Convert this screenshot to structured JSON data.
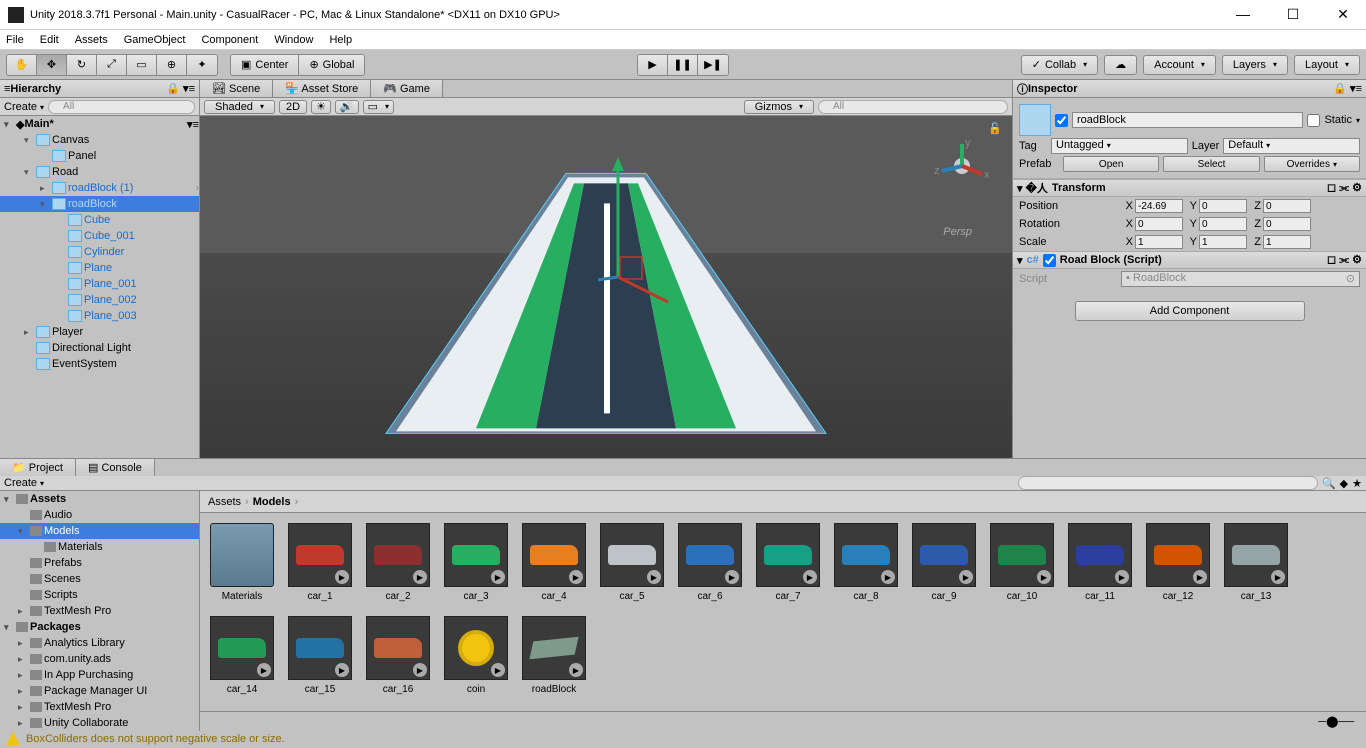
{
  "window": {
    "title": "Unity 2018.3.7f1 Personal - Main.unity - CasualRacer - PC, Mac & Linux Standalone* <DX11 on DX10 GPU>"
  },
  "menubar": [
    "File",
    "Edit",
    "Assets",
    "GameObject",
    "Component",
    "Window",
    "Help"
  ],
  "toolbar": {
    "center": "Center",
    "global": "Global",
    "collab": "Collab",
    "account": "Account",
    "layers": "Layers",
    "layout": "Layout"
  },
  "hierarchy": {
    "tab": "Hierarchy",
    "create": "Create",
    "search_placeholder": "All",
    "scene": "Main*",
    "items": [
      {
        "name": "Canvas",
        "depth": 1,
        "arrow": "▾"
      },
      {
        "name": "Panel",
        "depth": 2,
        "arrow": ""
      },
      {
        "name": "Road",
        "depth": 1,
        "arrow": "▾"
      },
      {
        "name": "roadBlock (1)",
        "depth": 2,
        "arrow": "▸",
        "blue": true
      },
      {
        "name": "roadBlock",
        "depth": 2,
        "arrow": "▾",
        "blue": true,
        "selected": true
      },
      {
        "name": "Cube",
        "depth": 3,
        "blue": true
      },
      {
        "name": "Cube_001",
        "depth": 3,
        "blue": true
      },
      {
        "name": "Cylinder",
        "depth": 3,
        "blue": true
      },
      {
        "name": "Plane",
        "depth": 3,
        "blue": true
      },
      {
        "name": "Plane_001",
        "depth": 3,
        "blue": true
      },
      {
        "name": "Plane_002",
        "depth": 3,
        "blue": true
      },
      {
        "name": "Plane_003",
        "depth": 3,
        "blue": true
      },
      {
        "name": "Player",
        "depth": 1,
        "arrow": "▸"
      },
      {
        "name": "Directional Light",
        "depth": 1
      },
      {
        "name": "EventSystem",
        "depth": 1
      }
    ]
  },
  "scene": {
    "tabs": [
      "Scene",
      "Asset Store",
      "Game"
    ],
    "shaded": "Shaded",
    "mode2d": "2D",
    "gizmos": "Gizmos",
    "search_placeholder": "All",
    "persp": "Persp"
  },
  "inspector": {
    "tab": "Inspector",
    "name": "roadBlock",
    "static": "Static",
    "tag_label": "Tag",
    "tag_value": "Untagged",
    "layer_label": "Layer",
    "layer_value": "Default",
    "prefab_label": "Prefab",
    "open": "Open",
    "select": "Select",
    "overrides": "Overrides",
    "transform": {
      "title": "Transform",
      "position": "Position",
      "rotation": "Rotation",
      "scale": "Scale",
      "pos": {
        "x": "-24.69",
        "y": "0",
        "z": "0"
      },
      "rot": {
        "x": "0",
        "y": "0",
        "z": "0"
      },
      "scl": {
        "x": "1",
        "y": "1",
        "z": "1"
      }
    },
    "script_comp": {
      "title": "Road Block (Script)",
      "script_label": "Script",
      "script_value": "RoadBlock"
    },
    "add_component": "Add Component"
  },
  "project": {
    "tabs": [
      "Project",
      "Console"
    ],
    "create": "Create",
    "breadcrumb": [
      "Assets",
      "Models"
    ],
    "tree": [
      {
        "name": "Assets",
        "depth": 0,
        "bold": true,
        "arrow": "▾"
      },
      {
        "name": "Audio",
        "depth": 1
      },
      {
        "name": "Models",
        "depth": 1,
        "selected": true,
        "arrow": "▾"
      },
      {
        "name": "Materials",
        "depth": 2
      },
      {
        "name": "Prefabs",
        "depth": 1
      },
      {
        "name": "Scenes",
        "depth": 1
      },
      {
        "name": "Scripts",
        "depth": 1
      },
      {
        "name": "TextMesh Pro",
        "depth": 1,
        "arrow": "▸"
      },
      {
        "name": "Packages",
        "depth": 0,
        "bold": true,
        "arrow": "▾"
      },
      {
        "name": "Analytics Library",
        "depth": 1,
        "arrow": "▸"
      },
      {
        "name": "com.unity.ads",
        "depth": 1,
        "arrow": "▸"
      },
      {
        "name": "In App Purchasing",
        "depth": 1,
        "arrow": "▸"
      },
      {
        "name": "Package Manager UI",
        "depth": 1,
        "arrow": "▸"
      },
      {
        "name": "TextMesh Pro",
        "depth": 1,
        "arrow": "▸"
      },
      {
        "name": "Unity Collaborate",
        "depth": 1,
        "arrow": "▸"
      }
    ],
    "assets": [
      {
        "name": "Materials",
        "type": "folder"
      },
      {
        "name": "car_1",
        "type": "model",
        "c": "#c0392b"
      },
      {
        "name": "car_2",
        "type": "model",
        "c": "#8e2f2f"
      },
      {
        "name": "car_3",
        "type": "model",
        "c": "#27ae60"
      },
      {
        "name": "car_4",
        "type": "model",
        "c": "#e67e22"
      },
      {
        "name": "car_5",
        "type": "model",
        "c": "#bdc3c7"
      },
      {
        "name": "car_6",
        "type": "model",
        "c": "#2c6fbb"
      },
      {
        "name": "car_7",
        "type": "model",
        "c": "#16a085"
      },
      {
        "name": "car_8",
        "type": "model",
        "c": "#2980b9"
      },
      {
        "name": "car_9",
        "type": "model",
        "c": "#2e5aac"
      },
      {
        "name": "car_10",
        "type": "model",
        "c": "#1e8449"
      },
      {
        "name": "car_11",
        "type": "model",
        "c": "#2c3e9e"
      },
      {
        "name": "car_12",
        "type": "model",
        "c": "#d35400"
      },
      {
        "name": "car_13",
        "type": "model",
        "c": "#95a5a6"
      },
      {
        "name": "car_14",
        "type": "model",
        "c": "#229954"
      },
      {
        "name": "car_15",
        "type": "model",
        "c": "#2471a3"
      },
      {
        "name": "car_16",
        "type": "model",
        "c": "#c0603b"
      },
      {
        "name": "coin",
        "type": "coin"
      },
      {
        "name": "roadBlock",
        "type": "road"
      }
    ]
  },
  "statusbar": {
    "message": "BoxColliders does not support negative scale or size."
  }
}
